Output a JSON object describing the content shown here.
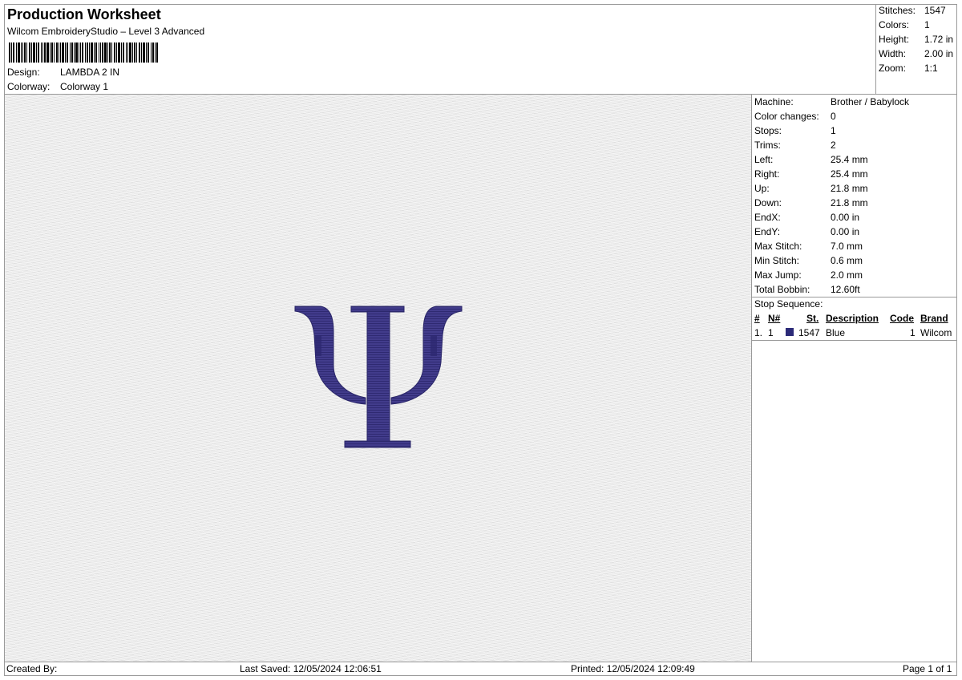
{
  "header": {
    "title": "Production Worksheet",
    "subtitle": "Wilcom EmbroideryStudio – Level 3 Advanced",
    "design_label": "Design:",
    "design_value": "LAMBDA 2 IN",
    "colorway_label": "Colorway:",
    "colorway_value": "Colorway 1"
  },
  "stats": [
    {
      "label": "Stitches:",
      "value": "1547"
    },
    {
      "label": "Colors:",
      "value": "1"
    },
    {
      "label": "Height:",
      "value": "1.72 in"
    },
    {
      "label": "Width:",
      "value": "2.00 in"
    },
    {
      "label": "Zoom:",
      "value": "1:1"
    }
  ],
  "info": [
    {
      "label": "Machine:",
      "value": "Brother / Babylock"
    },
    {
      "label": "Color changes:",
      "value": "0"
    },
    {
      "label": "Stops:",
      "value": "1"
    },
    {
      "label": "Trims:",
      "value": "2"
    },
    {
      "label": "Left:",
      "value": "25.4 mm"
    },
    {
      "label": "Right:",
      "value": "25.4 mm"
    },
    {
      "label": "Up:",
      "value": "21.8 mm"
    },
    {
      "label": "Down:",
      "value": "21.8 mm"
    },
    {
      "label": "EndX:",
      "value": "0.00 in"
    },
    {
      "label": "EndY:",
      "value": "0.00 in"
    },
    {
      "label": "Max Stitch:",
      "value": "7.0 mm"
    },
    {
      "label": "Min Stitch:",
      "value": "0.6 mm"
    },
    {
      "label": "Max Jump:",
      "value": "2.0 mm"
    },
    {
      "label": "Total Bobbin:",
      "value": "12.60ft"
    }
  ],
  "stop_sequence": {
    "title": "Stop Sequence:",
    "headers": {
      "num": "#",
      "n_num": "N#",
      "st": "St.",
      "description": "Description",
      "code": "Code",
      "brand": "Brand"
    },
    "rows": [
      {
        "num": "1.",
        "n_num": "1",
        "st": "1547",
        "description": "Blue",
        "code": "1",
        "brand": "Wilcom",
        "color": "#2b2a78"
      }
    ]
  },
  "design_preview": {
    "thread_color": "#3f3a8a",
    "icon": "psi-embroidery"
  },
  "footer": {
    "created_by": "Created By:",
    "last_saved": "Last Saved: 12/05/2024 12:06:51",
    "printed": "Printed: 12/05/2024 12:09:49",
    "page": "Page 1 of 1"
  }
}
